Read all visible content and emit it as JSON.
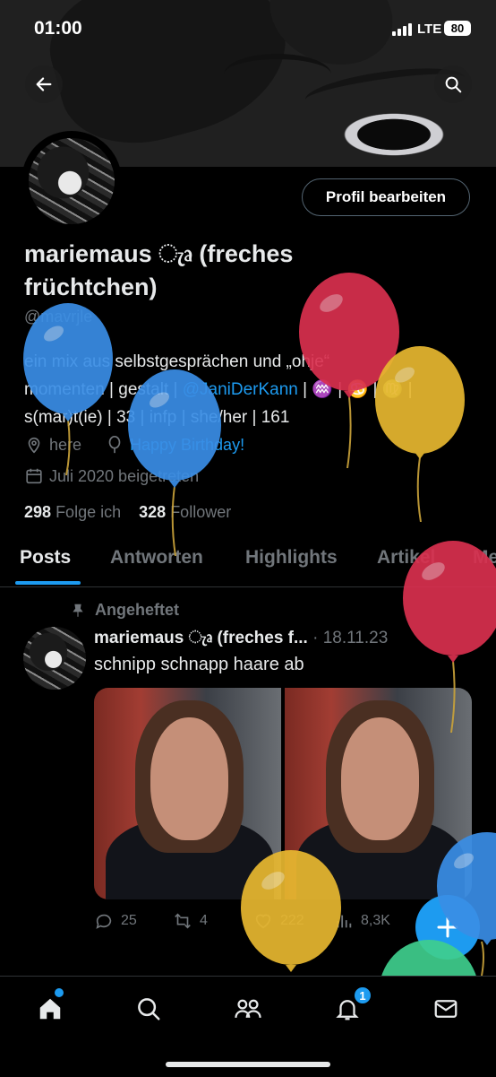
{
  "status": {
    "time": "01:00",
    "network": "LTE",
    "battery": "80"
  },
  "profile": {
    "edit_label": "Profil bearbeiten",
    "name": "mariemaus ැෘ (freches früchtchen)",
    "handle": "@mavrjle",
    "bio_line1": "ein mix aus selbstgesprächen und „ohje“",
    "bio_line2_a": "momenten | gestalt | ",
    "bio_mention": "@JaniDerKann",
    "bio_line2_b": " | ♒ | ♋ | ♍ |",
    "bio_line3": "s(mar)t(ie) | 33 | infp | she/her | 161",
    "location": "here",
    "website": "Happy Birthday!",
    "joined": "Juli 2020 beigetreten",
    "following_count": "298",
    "following_label": "Folge ich",
    "followers_count": "328",
    "followers_label": "Follower"
  },
  "tabs": [
    "Posts",
    "Antworten",
    "Highlights",
    "Artikel",
    "Me"
  ],
  "post": {
    "pinned_label": "Angeheftet",
    "author": "mariemaus ැෘ (freches f...",
    "date": "· 18.11.23",
    "text": "schnipp schnapp haare ab",
    "replies": "25",
    "reposts": "4",
    "likes": "222",
    "views": "8,3K"
  },
  "nav": {
    "notifications_badge": "1"
  },
  "colors": {
    "accent": "#1d9bf0",
    "balloon_red": "#d9304f",
    "balloon_yellow": "#e8b830",
    "balloon_blue": "#3a8ee6",
    "balloon_green": "#3fcf8e"
  }
}
